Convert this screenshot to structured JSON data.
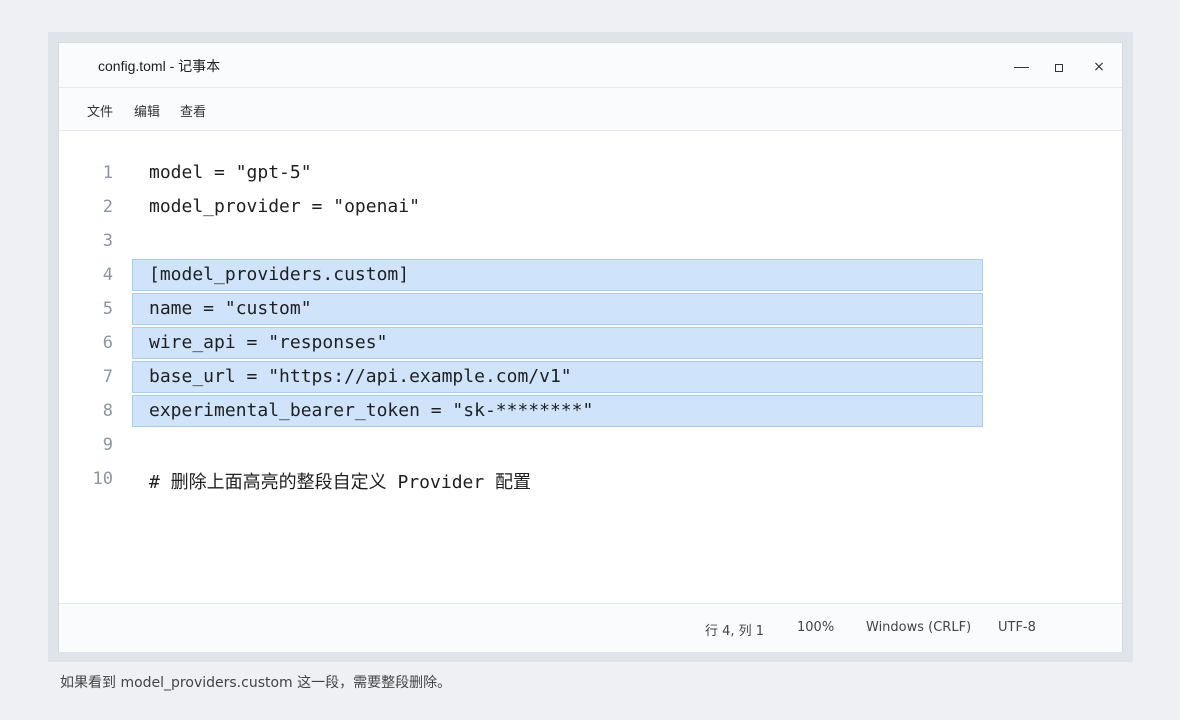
{
  "window": {
    "title": "config.toml - 记事本",
    "minimize_icon": "minimize-icon",
    "maximize_icon": "maximize-icon",
    "close_symbol": "×"
  },
  "menu": {
    "file": "文件",
    "edit": "编辑",
    "view": "查看"
  },
  "editor": {
    "lines": [
      {
        "num": "1",
        "text": "model = \"gpt-5\"",
        "highlighted": false
      },
      {
        "num": "2",
        "text": "model_provider = \"openai\"",
        "highlighted": false
      },
      {
        "num": "3",
        "text": "",
        "highlighted": false
      },
      {
        "num": "4",
        "text": "[model_providers.custom]",
        "highlighted": true
      },
      {
        "num": "5",
        "text": "name = \"custom\"",
        "highlighted": true
      },
      {
        "num": "6",
        "text": "wire_api = \"responses\"",
        "highlighted": true
      },
      {
        "num": "7",
        "text": "base_url = \"https://api.example.com/v1\"",
        "highlighted": true
      },
      {
        "num": "8",
        "text": "experimental_bearer_token = \"sk-********\"",
        "highlighted": true
      },
      {
        "num": "9",
        "text": "",
        "highlighted": false
      },
      {
        "num": "10",
        "text": "# 删除上面高亮的整段自定义 Provider 配置",
        "highlighted": false
      }
    ],
    "highlight_color": "#cfe4fb"
  },
  "status": {
    "position": "行 4, 列 1",
    "zoom": "100%",
    "line_ending": "Windows (CRLF)",
    "encoding": "UTF-8"
  },
  "caption": "如果看到 model_providers.custom 这一段，需要整段删除。"
}
